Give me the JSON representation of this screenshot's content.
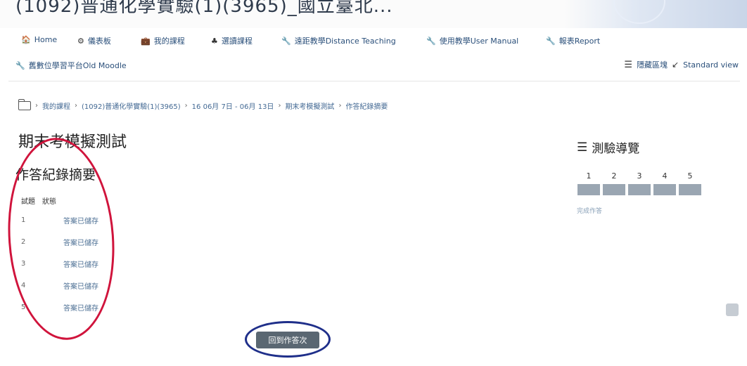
{
  "banner": {
    "title": "(1092)普通化學實驗(1)(3965)_國立臺北..."
  },
  "nav": {
    "items": [
      {
        "icon": "🏠",
        "label": "Home"
      },
      {
        "icon": "⚙",
        "label": "儀表板"
      },
      {
        "icon": "💼",
        "label": "我的課程"
      },
      {
        "icon": "♣",
        "label": "選讀課程"
      },
      {
        "icon": "🔧",
        "label": "遠距教學Distance Teaching"
      },
      {
        "icon": "🔧",
        "label": "使用教學User Manual"
      },
      {
        "icon": "🔧",
        "label": "報表Report"
      }
    ],
    "second_row": {
      "icon": "🔧",
      "label": "舊數位學習平台Old Moodle"
    },
    "hide_blocks": "隱藏區塊",
    "standard_view": "Standard view"
  },
  "breadcrumb": [
    "我的課程",
    "(1092)普通化學實驗(1)(3965)",
    "16 06月 7日 - 06月 13日",
    "期末考模擬測試",
    "作答紀錄摘要"
  ],
  "page": {
    "title": "期末考模擬測試",
    "subtitle": "作答紀錄摘要"
  },
  "summary": {
    "headers": {
      "question": "試題",
      "status": "狀態"
    },
    "rows": [
      {
        "q": "1",
        "status": "答案已儲存"
      },
      {
        "q": "2",
        "status": "答案已儲存"
      },
      {
        "q": "3",
        "status": "答案已儲存"
      },
      {
        "q": "4",
        "status": "答案已儲存"
      },
      {
        "q": "5",
        "status": "答案已儲存"
      }
    ]
  },
  "buttons": {
    "return": "回到作答次"
  },
  "quiz_nav": {
    "title": "測驗導覽",
    "questions": [
      "1",
      "2",
      "3",
      "4",
      "5"
    ],
    "finish": "完成作答"
  },
  "colors": {
    "annotation_red": "#d0143c",
    "annotation_blue": "#1f2f8a",
    "link": "#2a4f7a"
  }
}
